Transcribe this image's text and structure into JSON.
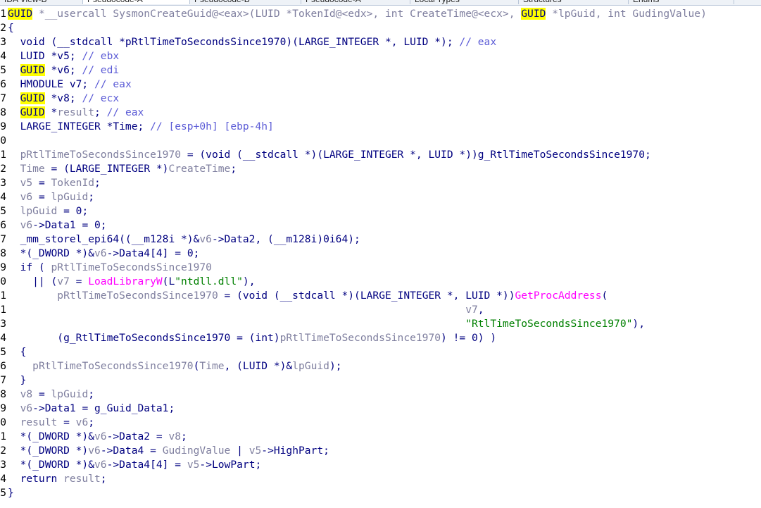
{
  "tabs": [
    {
      "label": "IDA View-B",
      "active": false
    },
    {
      "label": "Pseudocode-A",
      "active": true
    },
    {
      "label": "Pseudocode-B",
      "active": false
    },
    {
      "label": "Pseudocode-A",
      "active": false
    },
    {
      "label": "Local Types",
      "active": false
    },
    {
      "label": "Structures",
      "active": false
    },
    {
      "label": "Enums",
      "active": false
    }
  ],
  "colors": {
    "keyword": "#000080",
    "variable": "#0000ff",
    "gray": "#7f7f9f",
    "comment": "#5b5bd6",
    "import": "#ff00ff",
    "string": "#008000",
    "highlight": "#ffff00"
  },
  "code": [
    {
      "n": "1",
      "t": [
        [
          "hl",
          "GUID"
        ],
        [
          "g",
          " *__usercall SysmonCreateGuid@<eax>(LUID *TokenId@<edx>, int CreateTime@<ecx>, "
        ],
        [
          "hl",
          "GUID"
        ],
        [
          "g",
          " *lpGuid, int GudingValue)"
        ]
      ]
    },
    {
      "n": "2",
      "t": [
        [
          "k",
          "{"
        ]
      ]
    },
    {
      "n": "3",
      "t": [
        [
          "k",
          "  void (__stdcall *pRtlTimeToSecondsSince1970)(LARGE_INTEGER *, LUID *); "
        ],
        [
          "cm",
          "// eax"
        ]
      ]
    },
    {
      "n": "4",
      "t": [
        [
          "k",
          "  LUID *v5; "
        ],
        [
          "cm",
          "// ebx"
        ]
      ]
    },
    {
      "n": "5",
      "t": [
        [
          "k",
          "  "
        ],
        [
          "hl",
          "GUID"
        ],
        [
          "k",
          " *v6; "
        ],
        [
          "cm",
          "// edi"
        ]
      ]
    },
    {
      "n": "6",
      "t": [
        [
          "k",
          "  HMODULE v7; "
        ],
        [
          "cm",
          "// eax"
        ]
      ]
    },
    {
      "n": "7",
      "t": [
        [
          "k",
          "  "
        ],
        [
          "hl",
          "GUID"
        ],
        [
          "k",
          " *v8; "
        ],
        [
          "cm",
          "// ecx"
        ]
      ]
    },
    {
      "n": "8",
      "t": [
        [
          "k",
          "  "
        ],
        [
          "hl",
          "GUID"
        ],
        [
          "k",
          " *"
        ],
        [
          "g",
          "result"
        ],
        [
          "k",
          "; "
        ],
        [
          "cm",
          "// eax"
        ]
      ]
    },
    {
      "n": "9",
      "t": [
        [
          "k",
          "  LARGE_INTEGER *Time; "
        ],
        [
          "cm",
          "// [esp+0h] [ebp-4h]"
        ]
      ]
    },
    {
      "n": "0",
      "t": []
    },
    {
      "n": "1",
      "t": [
        [
          "k",
          "  "
        ],
        [
          "g",
          "pRtlTimeToSecondsSince1970"
        ],
        [
          "k",
          " = (void (__stdcall *)(LARGE_INTEGER *, LUID *))g_RtlTimeToSecondsSince1970;"
        ]
      ]
    },
    {
      "n": "2",
      "t": [
        [
          "k",
          "  "
        ],
        [
          "g",
          "Time"
        ],
        [
          "k",
          " = (LARGE_INTEGER *)"
        ],
        [
          "g",
          "CreateTime"
        ],
        [
          "k",
          ";"
        ]
      ]
    },
    {
      "n": "3",
      "t": [
        [
          "k",
          "  "
        ],
        [
          "g",
          "v5"
        ],
        [
          "k",
          " = "
        ],
        [
          "g",
          "TokenId"
        ],
        [
          "k",
          ";"
        ]
      ]
    },
    {
      "n": "4",
      "t": [
        [
          "k",
          "  "
        ],
        [
          "g",
          "v6"
        ],
        [
          "k",
          " = "
        ],
        [
          "g",
          "lpGuid"
        ],
        [
          "k",
          ";"
        ]
      ]
    },
    {
      "n": "5",
      "t": [
        [
          "k",
          "  "
        ],
        [
          "g",
          "lpGuid"
        ],
        [
          "k",
          " = 0;"
        ]
      ]
    },
    {
      "n": "6",
      "t": [
        [
          "k",
          "  "
        ],
        [
          "g",
          "v6"
        ],
        [
          "k",
          "->Data1 = 0;"
        ]
      ]
    },
    {
      "n": "7",
      "t": [
        [
          "k",
          "  _mm_storel_epi64((__m128i *)&"
        ],
        [
          "g",
          "v6"
        ],
        [
          "k",
          "->Data2, (__m128i)0i64);"
        ]
      ]
    },
    {
      "n": "8",
      "t": [
        [
          "k",
          "  *(_DWORD *)&"
        ],
        [
          "g",
          "v6"
        ],
        [
          "k",
          "->Data4[4] = 0;"
        ]
      ]
    },
    {
      "n": "9",
      "t": [
        [
          "k",
          "  if ( "
        ],
        [
          "g",
          "pRtlTimeToSecondsSince1970"
        ]
      ]
    },
    {
      "n": "0",
      "t": [
        [
          "k",
          "    || ("
        ],
        [
          "g",
          "v7"
        ],
        [
          "k",
          " = "
        ],
        [
          "imp",
          "LoadLibraryW"
        ],
        [
          "k",
          "("
        ],
        [
          "k",
          "L"
        ],
        [
          "str",
          "\"ntdll.dll\""
        ],
        [
          "k",
          "),"
        ]
      ]
    },
    {
      "n": "1",
      "t": [
        [
          "k",
          "        "
        ],
        [
          "g",
          "pRtlTimeToSecondsSince1970"
        ],
        [
          "k",
          " = (void (__stdcall *)(LARGE_INTEGER *, LUID *))"
        ],
        [
          "imp",
          "GetProcAddress"
        ],
        [
          "k",
          "("
        ]
      ]
    },
    {
      "n": "1",
      "t": [
        [
          "k",
          "                                                                          "
        ],
        [
          "g",
          "v7"
        ],
        [
          "k",
          ","
        ]
      ]
    },
    {
      "n": "3",
      "t": [
        [
          "k",
          "                                                                          "
        ],
        [
          "str",
          "\"RtlTimeToSecondsSince1970\""
        ],
        [
          "k",
          "),"
        ]
      ]
    },
    {
      "n": "4",
      "t": [
        [
          "k",
          "        (g_RtlTimeToSecondsSince1970 = (int)"
        ],
        [
          "g",
          "pRtlTimeToSecondsSince1970"
        ],
        [
          "k",
          ") != 0) )"
        ]
      ]
    },
    {
      "n": "5",
      "t": [
        [
          "k",
          "  {"
        ]
      ]
    },
    {
      "n": "6",
      "t": [
        [
          "k",
          "    "
        ],
        [
          "g",
          "pRtlTimeToSecondsSince1970"
        ],
        [
          "k",
          "("
        ],
        [
          "g",
          "Time"
        ],
        [
          "k",
          ", (LUID *)&"
        ],
        [
          "g",
          "lpGuid"
        ],
        [
          "k",
          ");"
        ]
      ]
    },
    {
      "n": "7",
      "t": [
        [
          "k",
          "  }"
        ]
      ]
    },
    {
      "n": "8",
      "t": [
        [
          "k",
          "  "
        ],
        [
          "g",
          "v8"
        ],
        [
          "k",
          " = "
        ],
        [
          "g",
          "lpGuid"
        ],
        [
          "k",
          ";"
        ]
      ]
    },
    {
      "n": "9",
      "t": [
        [
          "k",
          "  "
        ],
        [
          "g",
          "v6"
        ],
        [
          "k",
          "->Data1 = g_Guid_Data1;"
        ]
      ]
    },
    {
      "n": "0",
      "t": [
        [
          "k",
          "  "
        ],
        [
          "g",
          "result"
        ],
        [
          "k",
          " = "
        ],
        [
          "g",
          "v6"
        ],
        [
          "k",
          ";"
        ]
      ]
    },
    {
      "n": "1",
      "t": [
        [
          "k",
          "  *(_DWORD *)&"
        ],
        [
          "g",
          "v6"
        ],
        [
          "k",
          "->Data2 = "
        ],
        [
          "g",
          "v8"
        ],
        [
          "k",
          ";"
        ]
      ]
    },
    {
      "n": "2",
      "t": [
        [
          "k",
          "  *(_DWORD *)"
        ],
        [
          "g",
          "v6"
        ],
        [
          "k",
          "->Data4 = "
        ],
        [
          "g",
          "GudingValue"
        ],
        [
          "k",
          " | "
        ],
        [
          "g",
          "v5"
        ],
        [
          "k",
          "->HighPart;"
        ]
      ]
    },
    {
      "n": "3",
      "t": [
        [
          "k",
          "  *(_DWORD *)&"
        ],
        [
          "g",
          "v6"
        ],
        [
          "k",
          "->Data4[4] = "
        ],
        [
          "g",
          "v5"
        ],
        [
          "k",
          "->LowPart;"
        ]
      ]
    },
    {
      "n": "4",
      "t": [
        [
          "k",
          "  return "
        ],
        [
          "g",
          "result"
        ],
        [
          "k",
          ";"
        ]
      ]
    },
    {
      "n": "5",
      "t": [
        [
          "k",
          "}"
        ]
      ]
    }
  ]
}
